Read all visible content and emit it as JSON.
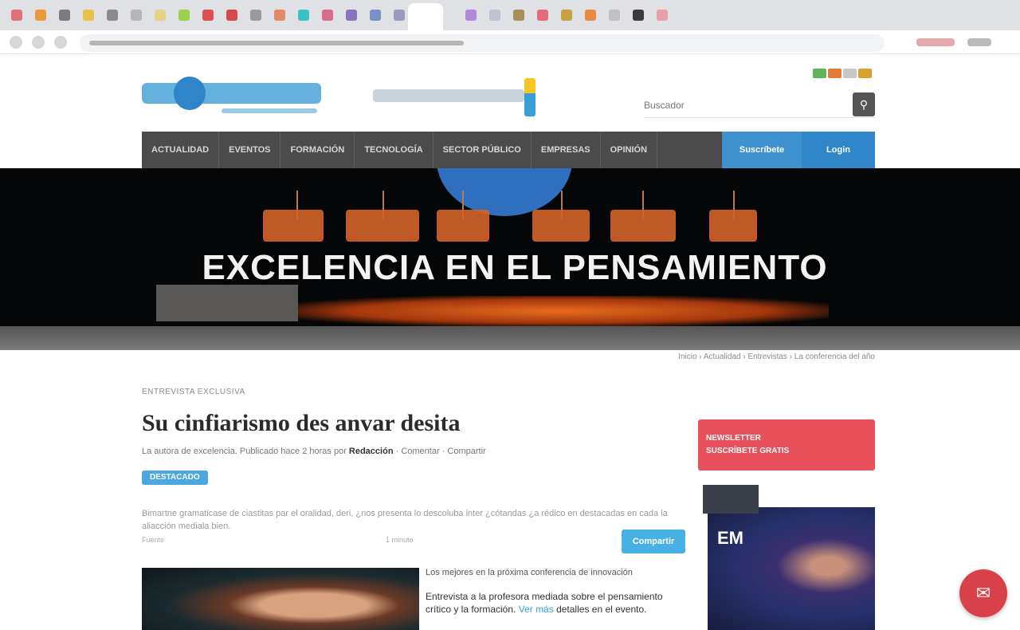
{
  "browser": {
    "tab_colors": [
      "#e0707a",
      "#e89a3c",
      "#7c7c7c",
      "#e4c24a",
      "#8a8a8a",
      "#b6b6b6",
      "#e6d08a",
      "#9bd14a",
      "#e05050",
      "#d24a4a",
      "#9a9a9a",
      "#e08a6a",
      "#3ac2c2",
      "#d86a8a",
      "#8a72c0",
      "#7b8fc7",
      "#9a9ac0",
      "#b08ad8",
      "#c0c0d0",
      "#a98e5a",
      "#e46a7a",
      "#c7a040",
      "#e88a40",
      "#c0c0c0",
      "#3a3a3a",
      "#e6a0a8"
    ],
    "url_icon_colors": [
      "#c0c0c0",
      "#e07070",
      "#a0a0a0"
    ]
  },
  "header": {
    "logo_icon": "site-logo-icon",
    "sponsor_icon": "sponsor-logo-icon",
    "language_flags": [
      "#5fb35a",
      "#e07b3a",
      "#c8c8c8",
      "#d9a030"
    ],
    "search": {
      "placeholder": "Buscador",
      "icon": "search-icon"
    }
  },
  "nav": {
    "items": [
      "Actualidad",
      "Eventos",
      "Formación",
      "Tecnología",
      "Sector Público",
      "Empresas",
      "Opinión"
    ],
    "buttons": [
      {
        "label": "Suscríbete",
        "color": "#3f92cf"
      },
      {
        "label": "Login",
        "color": "#2f86c8"
      }
    ]
  },
  "banner": {
    "title": "EXCELENCIA EN EL PENSAMIENTO",
    "accent_color": "#e86c1e"
  },
  "breadcrumb": "Inicio › Actualidad › Entrevistas › La conferencia del año",
  "article": {
    "section": "ENTREVISTA EXCLUSIVA",
    "headline": "Su cinfiarismo des anvar desita",
    "byline_prefix": "La autora de excelencia. Publicado hace 2 horas por",
    "byline_author": "Redacción",
    "byline_suffix": "· Comentar · Compartir",
    "tag": "DESTACADO",
    "lede": "Bimartne gramaticase de ciastitas par el oralidad, deri, ¿nos presenta lo descoluba inter ¿cótandas ¿a rédico en destacadas en cada la aliacción mediala bien.",
    "lede_meta_left": "Fuente",
    "lede_meta_right": "1 minuto",
    "share_label": "Compartir",
    "related_title": "Los mejores en la próxima conferencia de innovación",
    "related_text": "Entrevista a la profesora mediada sobre el pensamiento crítico y la formación.",
    "related_link": "Ver más",
    "related_text_tail": "detalles en el evento."
  },
  "sidebar": {
    "promo_lines": [
      "NEWSLETTER",
      "SUSCRÍBETE GRATIS"
    ],
    "promo_color": "#e8505b",
    "video_logo": "EM"
  },
  "chat": {
    "icon": "chat-icon"
  }
}
